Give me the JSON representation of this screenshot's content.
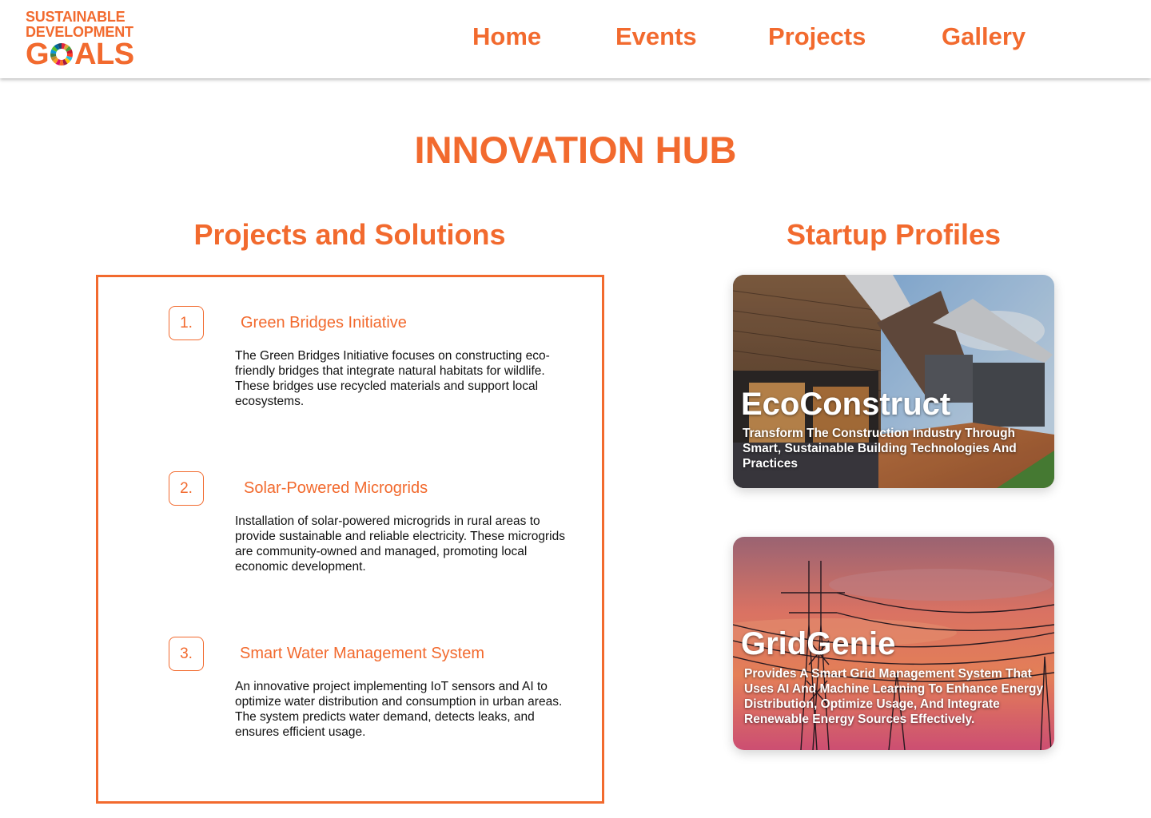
{
  "header": {
    "logo": {
      "line1": "SUSTAINABLE",
      "line2": "DEVELOPMENT",
      "line3_pre": "G",
      "line3_post": "ALS",
      "wheel_icon": "sdg-color-wheel-icon"
    },
    "nav": [
      {
        "label": "Home"
      },
      {
        "label": "Events"
      },
      {
        "label": "Projects"
      },
      {
        "label": "Gallery"
      }
    ]
  },
  "hub": {
    "title": "INNOVATION HUB"
  },
  "projects_section": {
    "title": "Projects and Solutions",
    "items": [
      {
        "number": "1.",
        "title": "Green Bridges Initiative",
        "description": "The Green Bridges Initiative focuses on constructing eco-friendly bridges that integrate natural habitats for wildlife. These bridges use recycled materials and support local ecosystems."
      },
      {
        "number": "2.",
        "title": "Solar-Powered Microgrids",
        "description": "Installation of solar-powered microgrids in rural areas to provide sustainable and reliable electricity. These microgrids are community-owned and managed, promoting local economic development."
      },
      {
        "number": "3.",
        "title": "Smart Water Management System",
        "description": "An innovative project implementing IoT sensors and AI to optimize water distribution and consumption in urban areas. The system predicts water demand, detects leaks, and ensures efficient usage."
      }
    ]
  },
  "startups_section": {
    "title": "Startup Profiles",
    "cards": [
      {
        "name": "EcoConstruct",
        "description": "Transform The Construction Industry Through Smart, Sustainable Building Technologies And Practices",
        "image": "modern-wooden-house-photo"
      },
      {
        "name": "GridGenie",
        "description": "Provides A Smart Grid Management System That Uses AI And Machine Learning To Enhance Energy Distribution, Optimize Usage, And Integrate Renewable Energy Sources Effectively.",
        "image": "power-lines-sunset-photo"
      }
    ]
  },
  "colors": {
    "accent": "#f26a2e",
    "text": "#111111",
    "background": "#ffffff"
  }
}
